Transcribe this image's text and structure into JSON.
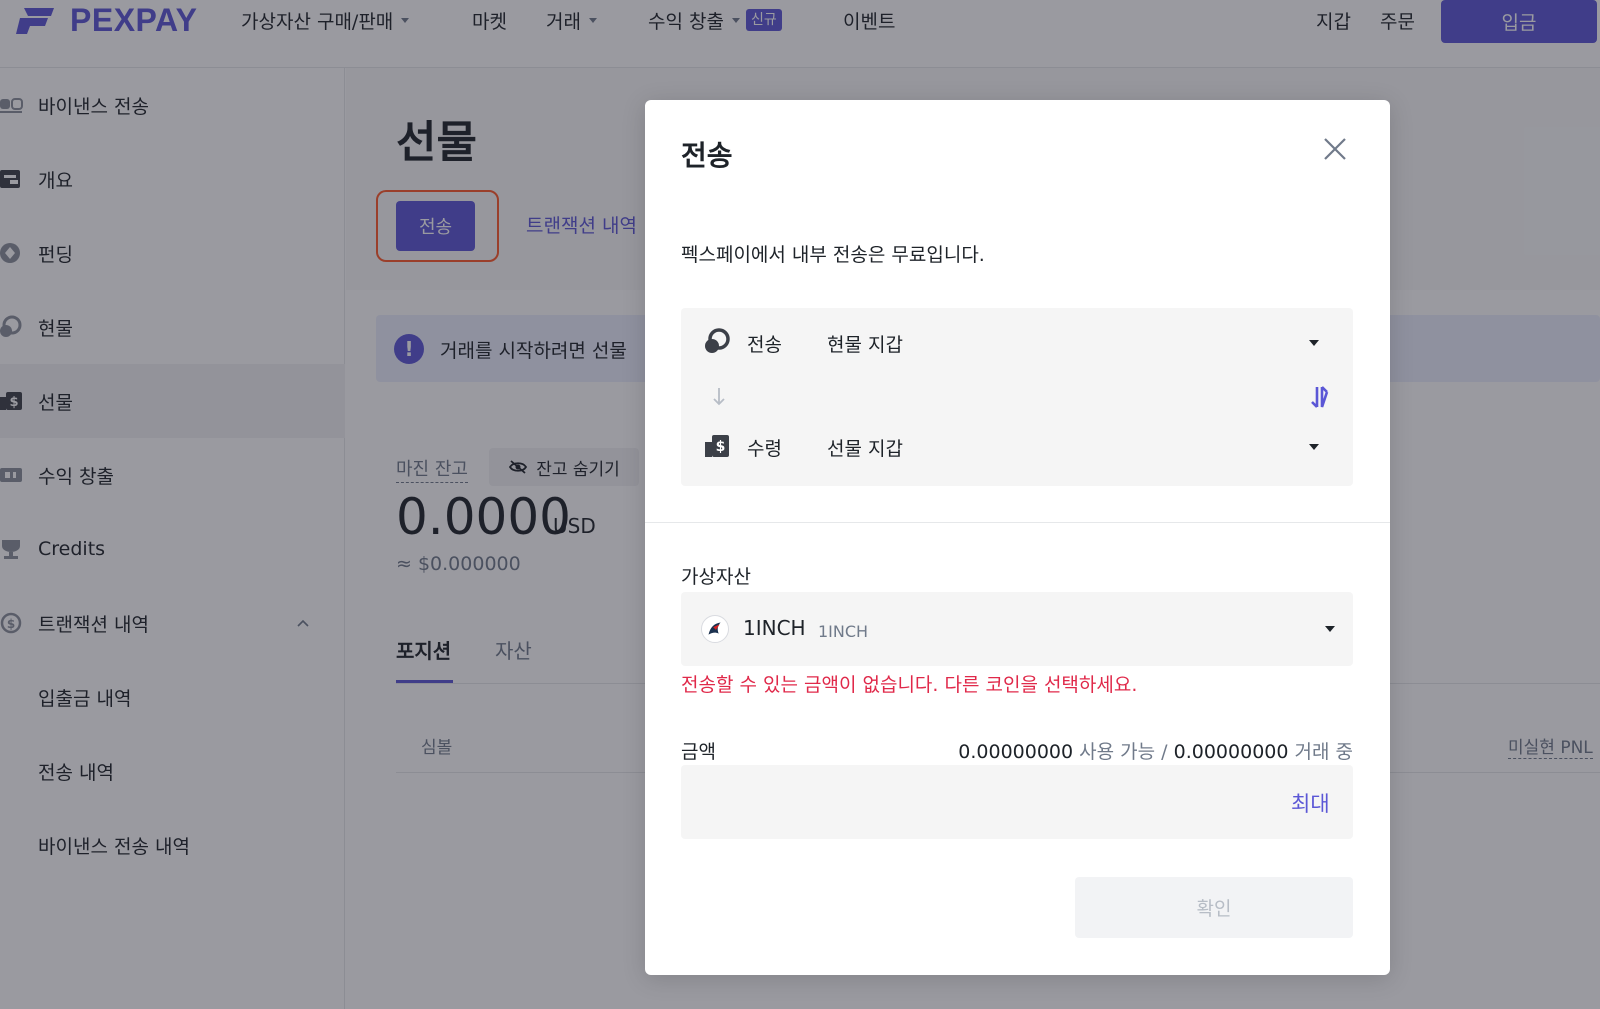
{
  "brand": {
    "name": "PEXPAY",
    "accent": "#5b57d6"
  },
  "nav": {
    "items": [
      {
        "label": "가상자산 구매/판매",
        "dropdown": true
      },
      {
        "label": "마켓",
        "dropdown": false
      },
      {
        "label": "거래",
        "dropdown": true
      },
      {
        "label": "수익 창출",
        "dropdown": true,
        "badge": "신규"
      },
      {
        "label": "이벤트",
        "dropdown": false
      }
    ],
    "wallet": "지갑",
    "orders": "주문",
    "deposit": "입금"
  },
  "sidebar": {
    "items": [
      {
        "label": "바이낸스 전송",
        "icon": "binance-transfer-icon"
      },
      {
        "label": "개요",
        "icon": "wallet-icon"
      },
      {
        "label": "펀딩",
        "icon": "funding-icon"
      },
      {
        "label": "현물",
        "icon": "spot-icon"
      },
      {
        "label": "선물",
        "icon": "futures-icon",
        "active": true
      },
      {
        "label": "수익 창출",
        "icon": "earn-icon"
      },
      {
        "label": "Credits",
        "icon": "trophy-icon"
      },
      {
        "label": "트랜잭션 내역",
        "icon": "history-icon",
        "expanded": true
      },
      {
        "label": "입출금 내역"
      },
      {
        "label": "전송 내역"
      },
      {
        "label": "바이낸스 전송 내역"
      }
    ]
  },
  "main": {
    "title": "선물",
    "transfer_button": "전송",
    "tx_history_link": "트랜잭션 내역",
    "notice": "거래를 시작하려면 선물",
    "margin_balance_label": "마진 잔고",
    "hide_balance": "잔고 숨기기",
    "balance": "0.0000",
    "balance_unit": "USD",
    "balance_approx": "≈ $0.000000",
    "tabs": [
      "포지션",
      "자산"
    ],
    "table": {
      "col_symbol": "심볼",
      "col_pnl": "미실현 PNL"
    }
  },
  "modal": {
    "title": "전송",
    "description": "펙스페이에서 내부 전송은 무료입니다.",
    "from_label": "전송",
    "from_value": "현물 지갑",
    "to_label": "수령",
    "to_value": "선물 지갑",
    "asset_label": "가상자산",
    "asset_name": "1INCH",
    "asset_ticker": "1INCH",
    "error": "전송할 수 있는 금액이 없습니다. 다른 코인을 선택하세요.",
    "amount_label": "금액",
    "available_value": "0.00000000",
    "available_text": "사용 가능",
    "separator": "/",
    "in_trade_value": "0.00000000",
    "in_trade_text": "거래 중",
    "amount_placeholder": "",
    "max": "최대",
    "confirm": "확인"
  },
  "colors": {
    "error": "#e0294a",
    "highlight": "#ff5a2a"
  }
}
